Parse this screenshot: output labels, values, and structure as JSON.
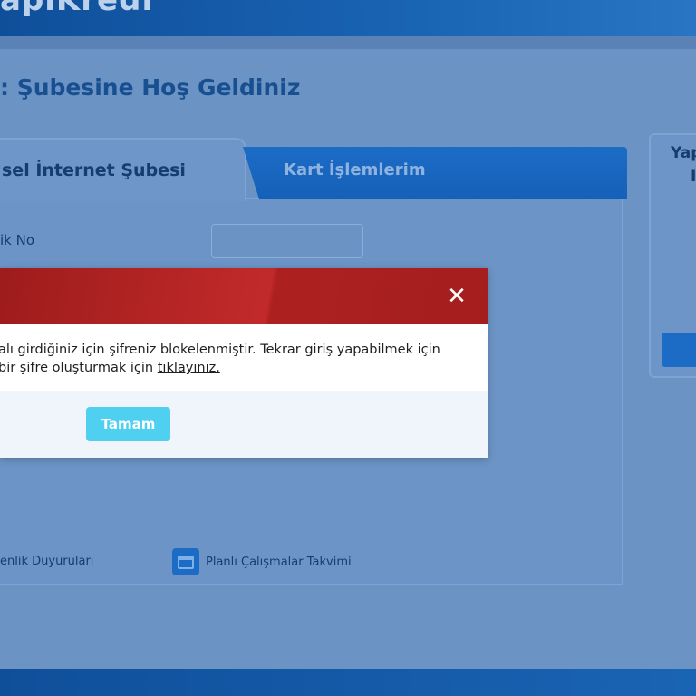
{
  "header": {
    "logo_text": "apıKredi"
  },
  "page": {
    "title": ": Şubesine Hoş Geldiniz"
  },
  "tabs": [
    {
      "label": "sel İnternet Şubesi",
      "active": true
    },
    {
      "label": "Kart İşlemlerim",
      "active": false
    }
  ],
  "form": {
    "id_label": "ik No",
    "id_value": ""
  },
  "footer_links": [
    {
      "label": "enlik Duyuruları"
    },
    {
      "label": "Planlı Çalışmalar Takvimi",
      "icon": "calendar-icon"
    }
  ],
  "side_panel": {
    "title_line1": "Yap",
    "title_line2": "I"
  },
  "modal": {
    "close_symbol": "✕",
    "message_line1": "alı girdiğiniz için şifreniz blokelenmiştir. Tekrar giriş yapabilmek için",
    "message_line2_prefix": "bir şifre oluşturmak için ",
    "message_link": "tıklayınız.",
    "ok_label": "Tamam"
  },
  "colors": {
    "brand_blue": "#1c6cc6",
    "modal_header_red": "#b02424",
    "ok_button": "#4fd0f0"
  }
}
